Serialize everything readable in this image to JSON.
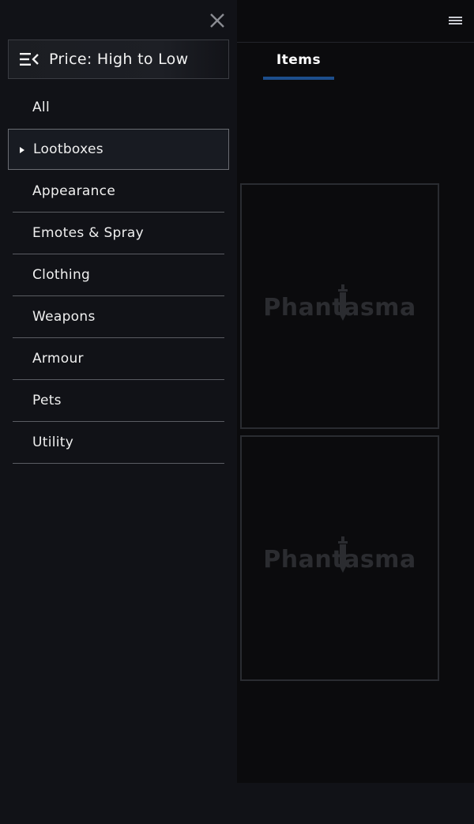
{
  "header": {
    "menu_icon": "hamburger-icon",
    "tabs": [
      {
        "label": "Items",
        "active": true
      }
    ]
  },
  "sidebar": {
    "close_icon": "close-icon",
    "sort": {
      "icon": "sort-menu-icon",
      "label": "Price: High to Low"
    },
    "categories": [
      {
        "label": "All"
      },
      {
        "label": "Lootboxes",
        "active": true
      },
      {
        "label": "Appearance"
      },
      {
        "label": "Emotes & Spray"
      },
      {
        "label": "Clothing"
      },
      {
        "label": "Weapons"
      },
      {
        "label": "Armour"
      },
      {
        "label": "Pets"
      },
      {
        "label": "Utility"
      }
    ]
  },
  "items": [
    {
      "placeholder_logo": "Phantasma"
    },
    {
      "placeholder_logo": "Phantasma"
    }
  ],
  "colors": {
    "background": "#0b0b0d",
    "sidebar": "#111217",
    "accent": "#1d4e8c",
    "text": "#f0f0f0"
  }
}
